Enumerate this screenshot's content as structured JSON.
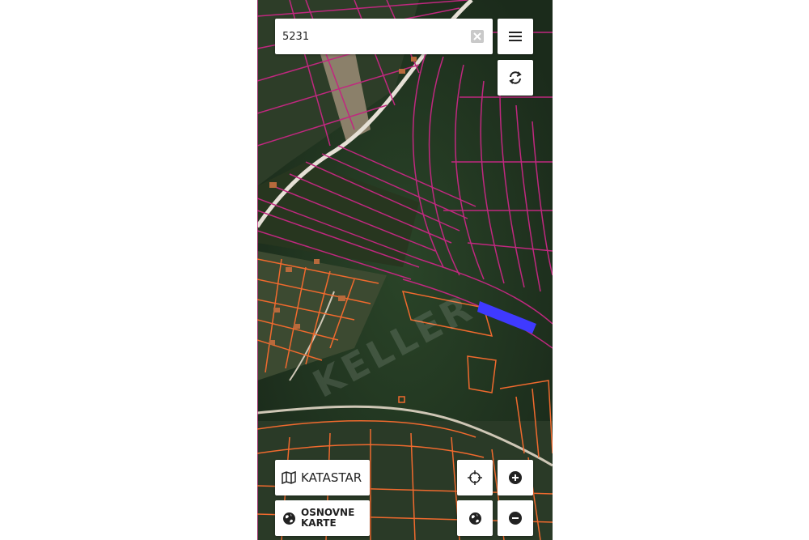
{
  "search": {
    "value": "5231"
  },
  "controls": {
    "katastar_label": "KATASTAR",
    "osnovne_label_line1": "OSNOVNE",
    "osnovne_label_line2": "KARTE"
  },
  "icons": {
    "menu": "hamburger-icon",
    "refresh": "refresh-icon",
    "clear": "clear-icon",
    "katastar": "map-icon",
    "osnovne": "globe-icon",
    "locate": "crosshair-icon",
    "layers": "globe-icon",
    "zoom_in": "plus-circle-icon",
    "zoom_out": "minus-circle-icon"
  },
  "colors": {
    "upper_parcel_lines": "#c0287f",
    "lower_parcel_lines": "#f06a2e",
    "selected_parcel": "#3f3aff",
    "vegetation": "#1f3320",
    "road": "#e6e0d6"
  },
  "watermark": "KELLER"
}
